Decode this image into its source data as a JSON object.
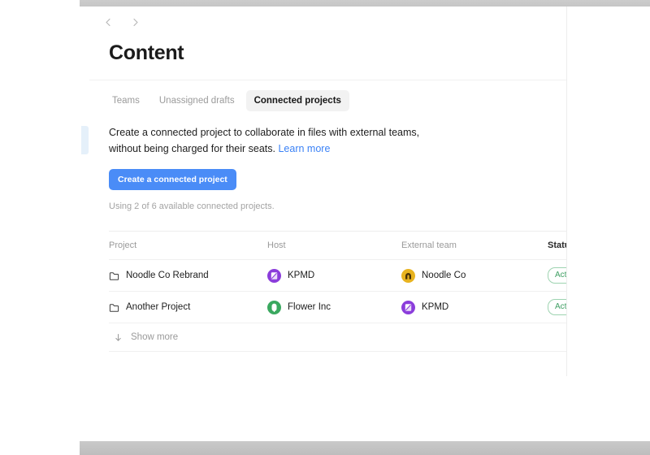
{
  "window": {
    "top_bar_color": "#c8c8c8",
    "bottom_bar_color": "#c3c3c3"
  },
  "nav": {
    "back_icon": "chevron-left-icon",
    "forward_icon": "chevron-right-icon"
  },
  "header": {
    "title": "Content"
  },
  "tabs": [
    {
      "label": "Teams",
      "active": false
    },
    {
      "label": "Unassigned drafts",
      "active": false
    },
    {
      "label": "Connected projects",
      "active": true
    }
  ],
  "description": {
    "text": "Create a connected project to collaborate in files with external teams, without being charged for their seats.",
    "link_label": "Learn more",
    "link_color": "#3b82f6"
  },
  "cta": {
    "label": "Create a connected project",
    "color": "#4a8cf7"
  },
  "usage": {
    "note": "Using 2 of 6 available connected projects."
  },
  "table": {
    "columns": [
      "Project",
      "Host",
      "External team",
      "Status"
    ],
    "rows": [
      {
        "project": "Noodle Co Rebrand",
        "project_icon": "folder-icon",
        "host": "KPMD",
        "host_avatar": "kpmd-avatar",
        "host_avatar_color": "#8b3ddb",
        "external_team": "Noodle Co",
        "external_avatar": "noodle-co-avatar",
        "external_avatar_color": "#e8b31f",
        "status": "Active",
        "status_color": "#3e9e62"
      },
      {
        "project": "Another Project",
        "project_icon": "folder-icon",
        "host": "Flower Inc",
        "host_avatar": "flower-inc-avatar",
        "host_avatar_color": "#3aa85f",
        "external_team": "KPMD",
        "external_avatar": "kpmd-avatar",
        "external_avatar_color": "#8b3ddb",
        "status": "Active",
        "status_color": "#3e9e62"
      }
    ],
    "show_more_label": "Show more",
    "show_more_icon": "arrow-down-icon"
  },
  "sidebar": {
    "selected_item_color": "#e5f0fa"
  }
}
